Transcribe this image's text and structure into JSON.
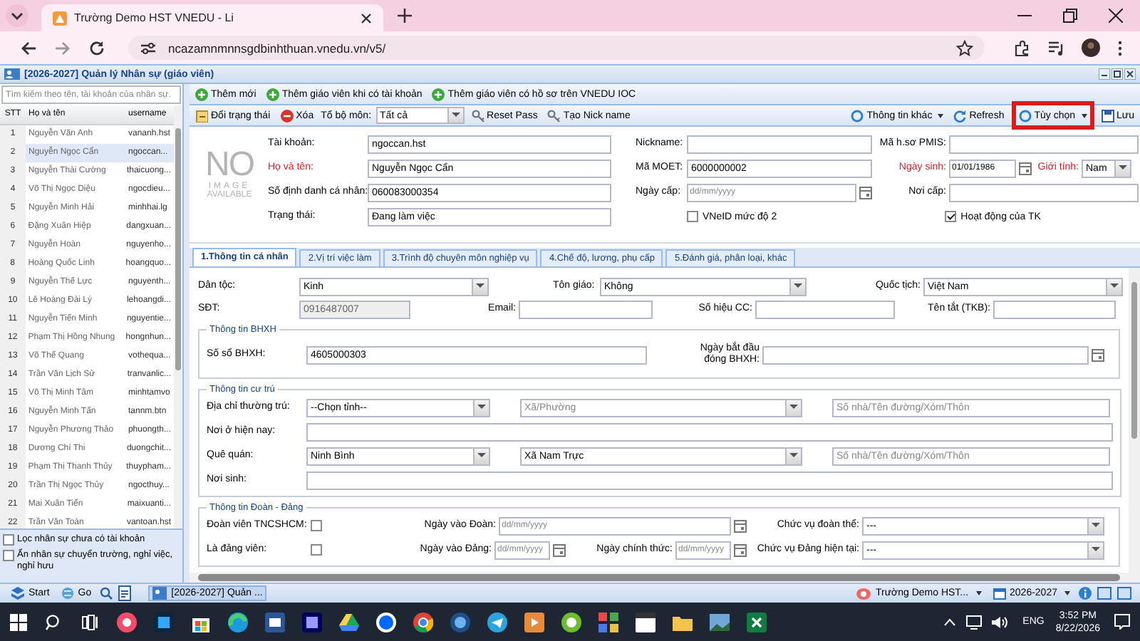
{
  "browser": {
    "tab_title": "Trường Demo HST VNEDU - Li",
    "url": "ncazamnmnnsgdbinhthuan.vnedu.vn/v5/"
  },
  "app": {
    "title": "[2026-2027] Quản lý Nhân sự (giáo viên)"
  },
  "staff_list": {
    "search_placeholder": "Tìm kiếm theo tên, tài khoản của nhân sự.",
    "columns": [
      "STT",
      "Họ và tên",
      "username"
    ],
    "rows": [
      {
        "stt": "1",
        "name": "Nguyễn Văn Anh",
        "username": "vananh.hst",
        "selected": false
      },
      {
        "stt": "2",
        "name": "Nguyễn Ngọc Cẩn",
        "username": "ngoccan...",
        "selected": true
      },
      {
        "stt": "3",
        "name": "Nguyễn Thái Cường",
        "username": "thaicuong...",
        "selected": false
      },
      {
        "stt": "4",
        "name": "Võ Thị Ngọc Diệu",
        "username": "ngocdieu...",
        "selected": false
      },
      {
        "stt": "5",
        "name": "Nguyễn Minh Hải",
        "username": "minhhai.lg",
        "selected": false
      },
      {
        "stt": "6",
        "name": "Đặng Xuân Hiệp",
        "username": "dangxuan...",
        "selected": false
      },
      {
        "stt": "7",
        "name": "Nguyễn Hoàn",
        "username": "nguyenho...",
        "selected": false
      },
      {
        "stt": "8",
        "name": "Hoàng Quốc Linh",
        "username": "hoangquo...",
        "selected": false
      },
      {
        "stt": "9",
        "name": "Nguyễn Thế Lực",
        "username": "nguyenth...",
        "selected": false
      },
      {
        "stt": "10",
        "name": "Lê Hoàng Đài Lý",
        "username": "lehoangdi...",
        "selected": false
      },
      {
        "stt": "11",
        "name": "Nguyễn Tiến Minh",
        "username": "nguyentie...",
        "selected": false
      },
      {
        "stt": "12",
        "name": "Phạm Thị Hồng Nhung",
        "username": "hongnhun...",
        "selected": false
      },
      {
        "stt": "13",
        "name": "Võ Thế Quang",
        "username": "vothequa...",
        "selected": false
      },
      {
        "stt": "14",
        "name": "Trần Văn Lịch Sử",
        "username": "tranvanlic...",
        "selected": false
      },
      {
        "stt": "15",
        "name": "Võ Thị Minh Tâm",
        "username": "minhtamvo",
        "selected": false
      },
      {
        "stt": "16",
        "name": "Nguyễn Minh Tấn",
        "username": "tannm.btn",
        "selected": false
      },
      {
        "stt": "17",
        "name": "Nguyễn Phương Thảo",
        "username": "phuongth...",
        "selected": false
      },
      {
        "stt": "18",
        "name": "Dương Chí Thi",
        "username": "duongchit...",
        "selected": false
      },
      {
        "stt": "19",
        "name": "Phạm Thị Thanh Thủy",
        "username": "thuypham...",
        "selected": false
      },
      {
        "stt": "20",
        "name": "Trần Thị Ngọc Thủy",
        "username": "ngocthuy...",
        "selected": false
      },
      {
        "stt": "21",
        "name": "Mai Xuân Tiến",
        "username": "maixuanti...",
        "selected": false
      },
      {
        "stt": "22",
        "name": "Trần Văn Toàn",
        "username": "vantoan.hst",
        "selected": false
      }
    ],
    "filters": [
      {
        "label": "Lọc nhân sự chưa có tài khoản",
        "checked": false
      },
      {
        "label": "Ẩn nhân sự chuyển trường, nghỉ việc, nghỉ hưu",
        "checked": false
      }
    ]
  },
  "toolbar_1": [
    {
      "label": "Thêm mới"
    },
    {
      "label": "Thêm giáo viên khi có tài khoản"
    },
    {
      "label": "Thêm giáo viên có hồ sơ trên VNEDU IOC"
    }
  ],
  "toolbar_2": {
    "left": [
      {
        "kind": "button",
        "label": "Đổi trạng thái"
      },
      {
        "kind": "button",
        "label": "Xóa"
      },
      {
        "kind": "select",
        "label": "Tổ bộ môn:",
        "value": "Tất cả"
      },
      {
        "kind": "button",
        "label": "Reset Pass"
      },
      {
        "kind": "button",
        "label": "Tạo Nick name"
      }
    ],
    "right": [
      {
        "kind": "menu",
        "label": "Thông tin khác",
        "highlighted": false
      },
      {
        "kind": "button",
        "label": "Refresh",
        "highlighted": false
      },
      {
        "kind": "menu",
        "label": "Tùy chọn",
        "highlighted": true
      },
      {
        "kind": "button",
        "label": "Lưu",
        "highlighted": false
      }
    ]
  },
  "profile": {
    "photo_text": [
      "NO",
      "IMAGE",
      "AVAILABLE"
    ],
    "rows": [
      [
        {
          "label": "Tài khoản:",
          "kind": "text",
          "value": "ngoccan.hst",
          "required": false
        },
        {
          "label": "Nickname:",
          "kind": "text",
          "required": false
        },
        {
          "label": "Mã h.sơ PMIS:",
          "kind": "text",
          "required": false
        }
      ],
      [
        {
          "label": "Họ và tên:",
          "kind": "text",
          "value": "Nguyễn Ngọc Cẩn",
          "required": true
        },
        {
          "label": "Mã MOET:",
          "kind": "text",
          "value": "6000000002",
          "required": false
        },
        {
          "label": "Ngày sinh:",
          "kind": "date",
          "value": "01/01/1986",
          "required": true
        },
        {
          "label": "Giới tính:",
          "kind": "select",
          "value": "Nam",
          "required": true
        }
      ],
      [
        {
          "label": "Số định danh cá nhân:",
          "kind": "text",
          "value": "060083000354",
          "required": false
        },
        {
          "label": "Ngày cấp:",
          "kind": "date",
          "placeholder": "dd/mm/yyyy",
          "required": false
        },
        {
          "label": "Nơi cấp:",
          "kind": "text",
          "required": false
        }
      ],
      [
        {
          "label": "Trạng thái:",
          "kind": "text",
          "value": "Đang làm việc",
          "required": false
        },
        {
          "label": "VNeID mức độ 2",
          "kind": "checkbox",
          "checked": false
        },
        {
          "label": "Hoạt động của TK",
          "kind": "checkbox",
          "checked": true
        }
      ]
    ]
  },
  "tabs": [
    {
      "label": "1.Thông tin cá nhân",
      "selected": true
    },
    {
      "label": "2.Vị trí việc làm",
      "selected": false
    },
    {
      "label": "3.Trình độ chuyên môn nghiệp vụ",
      "selected": false
    },
    {
      "label": "4.Chế độ, lương, phụ cấp",
      "selected": false
    },
    {
      "label": "5.Đánh giá, phân loại, khác",
      "selected": false
    }
  ],
  "sections": [
    {
      "rows": [
        {
          "fields": [
            {
              "label": "Dân tộc:",
              "kind": "select",
              "value": "Kinh",
              "disabled": false
            },
            {
              "label": "Tôn giáo:",
              "kind": "select",
              "value": "Không",
              "disabled": false
            },
            {
              "label": "Quốc tịch:",
              "kind": "select",
              "value": "Việt Nam",
              "disabled": false
            }
          ]
        },
        {
          "fields": [
            {
              "label": "SĐT:",
              "kind": "text",
              "value": "0916487007",
              "disabled": true
            },
            {
              "label": "Email:",
              "kind": "text",
              "disabled": false
            },
            {
              "label": "Số hiệu CC:",
              "kind": "text",
              "disabled": false
            },
            {
              "label": "Tên tắt (TKB):",
              "kind": "text",
              "disabled": false
            }
          ]
        }
      ]
    },
    {
      "title": "Thông tin BHXH",
      "rows": [
        {
          "fields": [
            {
              "label": "Số sổ BHXH:",
              "kind": "text",
              "value": "4605000303",
              "disabled": false
            },
            {
              "label": "Ngày bắt đầu đóng BHXH:",
              "kind": "date",
              "disabled": false
            }
          ]
        }
      ]
    },
    {
      "title": "Thông tin cư trú",
      "rows": [
        {
          "fields": [
            {
              "label": "Địa chỉ thường trú:",
              "kind": "select",
              "value": "--Chọn tỉnh--",
              "disabled": false
            },
            {
              "kind": "select",
              "placeholder": "Xã/Phường",
              "disabled": false
            },
            {
              "kind": "text",
              "placeholder": "Số nhà/Tên đường/Xóm/Thôn",
              "disabled": false
            }
          ]
        },
        {
          "fields": [
            {
              "label": "Nơi ở hiện nay:",
              "kind": "text",
              "disabled": false
            }
          ]
        },
        {
          "fields": [
            {
              "label": "Quê quán:",
              "kind": "select",
              "value": "Ninh Bình",
              "disabled": false
            },
            {
              "kind": "select",
              "value": "Xã Nam Trực",
              "disabled": false
            },
            {
              "kind": "text",
              "placeholder": "Số nhà/Tên đường/Xóm/Thôn",
              "disabled": false
            }
          ]
        },
        {
          "fields": [
            {
              "label": "Nơi sinh:",
              "kind": "text",
              "disabled": false
            }
          ]
        }
      ]
    },
    {
      "title": "Thông tin Đoàn - Đảng",
      "rows": [
        {
          "fields": [
            {
              "label": "Đoàn viên TNCSHCM:",
              "kind": "checkbox",
              "checked": false
            },
            {
              "label": "Ngày vào Đoàn:",
              "kind": "date",
              "placeholder": "dd/mm/yyyy",
              "disabled": false
            },
            {
              "label": "Chức vụ đoàn thể:",
              "kind": "select",
              "value": "---",
              "disabled": false
            }
          ]
        },
        {
          "fields": [
            {
              "label": "Là đảng viên:",
              "kind": "checkbox",
              "checked": false
            },
            {
              "label": "Ngày vào Đảng:",
              "kind": "date",
              "placeholder": "dd/mm/yyyy",
              "disabled": false
            },
            {
              "label": "Ngày chính thức:",
              "kind": "date",
              "placeholder": "dd/mm/yyyy",
              "disabled": false
            },
            {
              "label": "Chức vụ Đảng hiện tại:",
              "kind": "select",
              "value": "---",
              "disabled": false
            }
          ]
        }
      ]
    }
  ],
  "app_bar": {
    "start": "Start",
    "go": "Go",
    "window": "[2026-2027] Quản ...",
    "school": "Trường Demo HST...",
    "year": "2026-2027"
  },
  "taskbar": {
    "language": "ENG",
    "time": "3:52 PM",
    "date": "8/22/2026"
  }
}
